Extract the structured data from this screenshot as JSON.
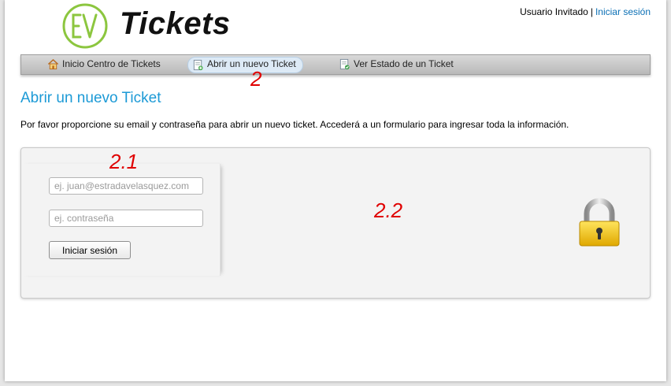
{
  "header": {
    "logo_text": "Tickets",
    "user_label": "Usuario Invitado",
    "separator": "|",
    "login_link": "Iniciar sesión"
  },
  "nav": {
    "items": [
      {
        "label": "Inicio Centro de Tickets",
        "icon": "home-icon"
      },
      {
        "label": "Abrir un nuevo Ticket",
        "icon": "new-ticket-icon",
        "active": true
      },
      {
        "label": "Ver Estado de un Ticket",
        "icon": "ticket-status-icon"
      }
    ]
  },
  "annotations": {
    "nav": "2",
    "login_form": "2.1",
    "panel": "2.2"
  },
  "main": {
    "title": "Abrir un nuevo Ticket",
    "intro": "Por favor proporcione su email y contraseña para abrir un nuevo ticket. Accederá a un formulario para ingresar toda la información.",
    "login": {
      "email_placeholder": "ej. juan@estradavelasquez.com",
      "password_placeholder": "ej. contraseña",
      "submit_label": "Iniciar sesión"
    }
  },
  "colors": {
    "link": "#0a6fb5",
    "title": "#1c9ad6",
    "logo_green": "#8cc63f",
    "annotation_red": "#e00000"
  }
}
